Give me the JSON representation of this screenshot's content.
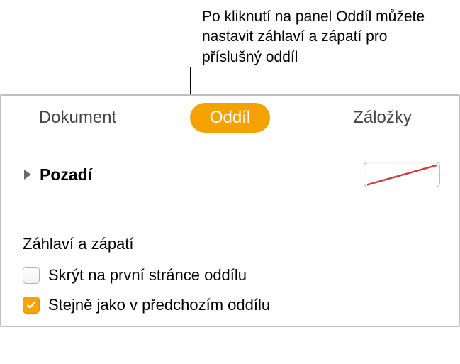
{
  "annotation": "Po kliknutí na panel Oddíl můžete nastavit záhlaví a zápatí pro příslušný oddíl",
  "tabs": {
    "document": "Dokument",
    "section": "Oddíl",
    "bookmarks": "Záložky"
  },
  "background": {
    "label": "Pozadí"
  },
  "headers_footers": {
    "title": "Záhlaví a zápatí",
    "hide_first": "Skrýt na první stránce oddílu",
    "same_prev": "Stejně jako v předchozím oddílu"
  }
}
